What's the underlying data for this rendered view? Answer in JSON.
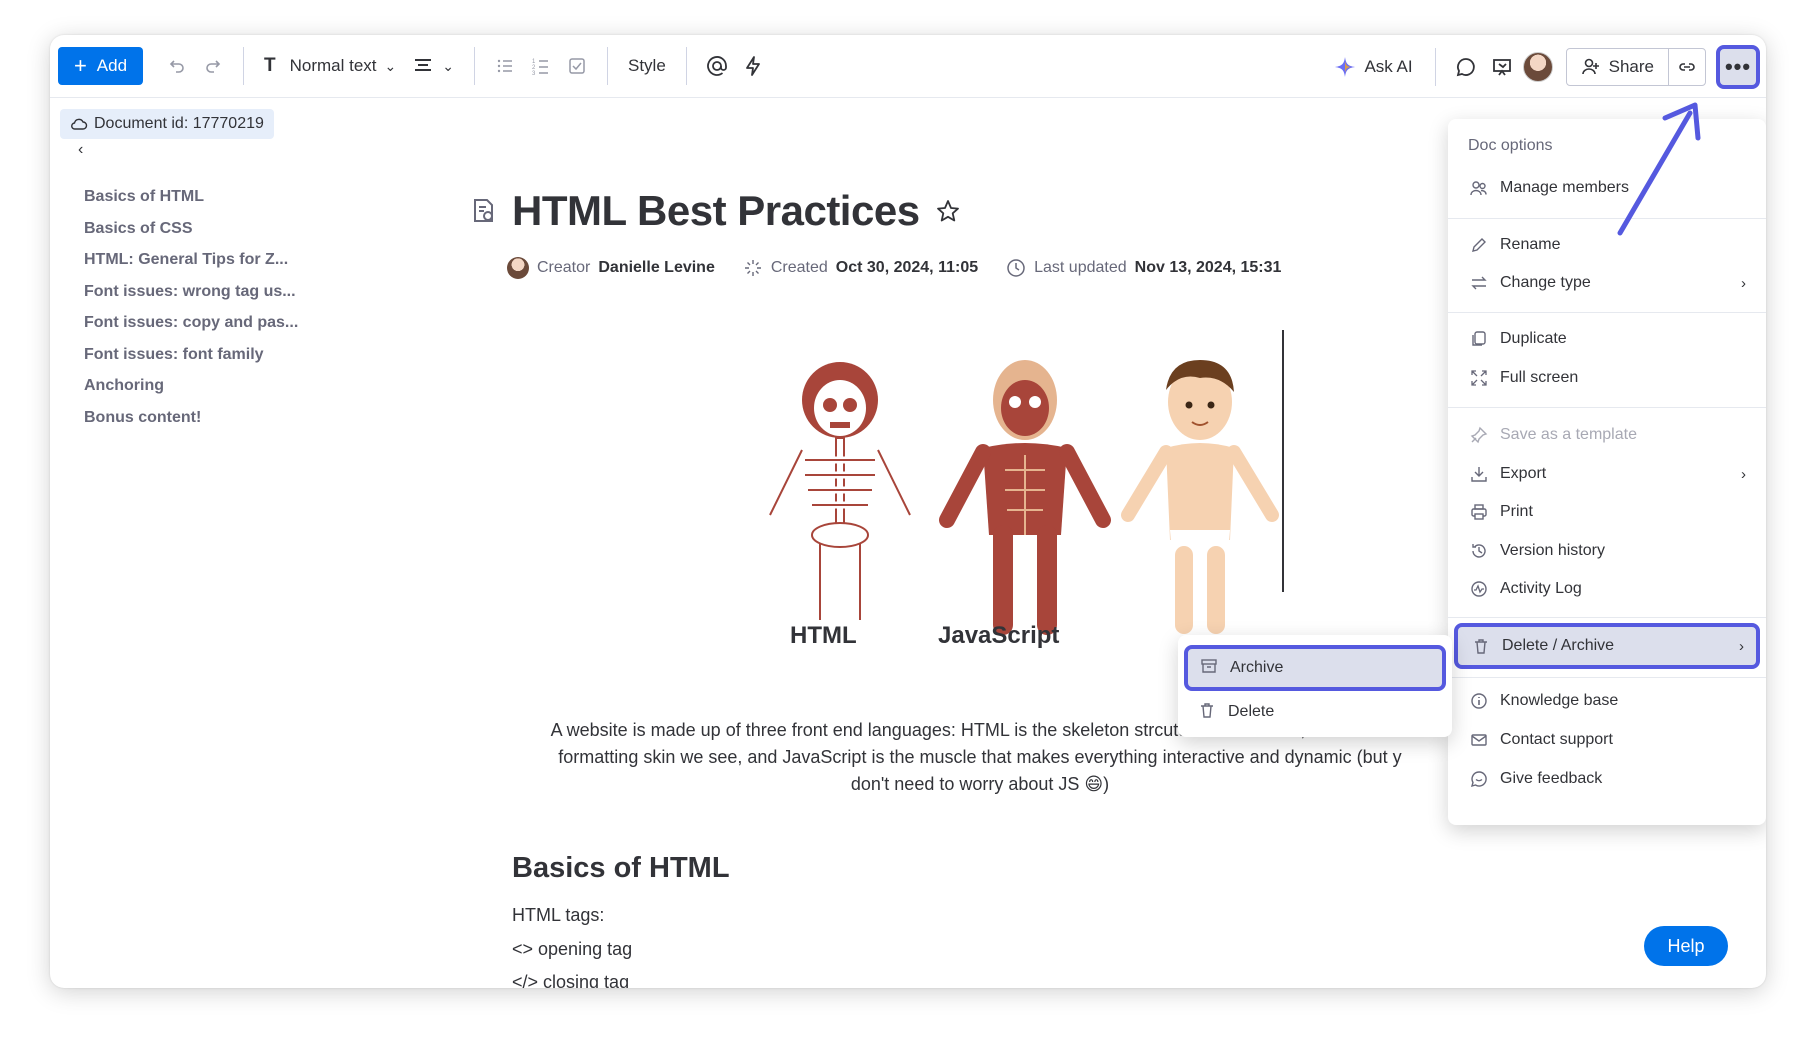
{
  "toolbar": {
    "add_label": "Add",
    "text_style": "Normal text",
    "style_label": "Style",
    "ask_ai_label": "Ask AI",
    "share_label": "Share",
    "more_label": "•••"
  },
  "doc_id": "Document id: 17770219",
  "toc": [
    "Basics of HTML",
    "Basics of CSS",
    "HTML: General Tips for Z...",
    "Font issues: wrong tag us...",
    "Font issues: copy and pas...",
    "Font issues: font family",
    "Anchoring",
    "Bonus content!"
  ],
  "doc": {
    "title": "HTML Best Practices",
    "creator_label": "Creator",
    "creator": "Danielle Levine",
    "created_label": "Created",
    "created": "Oct 30, 2024, 11:05",
    "updated_label": "Last updated",
    "updated": "Nov 13, 2024, 15:31",
    "fig_labels": [
      "HTML",
      "JavaScript"
    ],
    "paragraph_line1": "A website is made up of three front end languages: HTML is the skeleton strcuture underneath, CSS is the c",
    "paragraph_line2": "formatting skin we see, and JavaScript is the muscle that makes everything interactive and dynamic (but y",
    "paragraph_line3": "don't need to worry about JS 😄)",
    "h2": "Basics of HTML",
    "lines": [
      "HTML tags:",
      "<> opening tag",
      "</> closing tag"
    ]
  },
  "menu": {
    "header": "Doc options",
    "items": {
      "manage_members": "Manage members",
      "rename": "Rename",
      "change_type": "Change type",
      "duplicate": "Duplicate",
      "full_screen": "Full screen",
      "save_template": "Save as a template",
      "export": "Export",
      "print": "Print",
      "version_history": "Version history",
      "activity_log": "Activity Log",
      "delete_archive": "Delete / Archive",
      "knowledge_base": "Knowledge base",
      "contact_support": "Contact support",
      "give_feedback": "Give feedback"
    }
  },
  "submenu": {
    "archive": "Archive",
    "delete": "Delete"
  },
  "help_label": "Help",
  "colors": {
    "primary": "#0073ea",
    "highlight_border": "#5559df",
    "highlight_bg": "#dcdfec"
  }
}
